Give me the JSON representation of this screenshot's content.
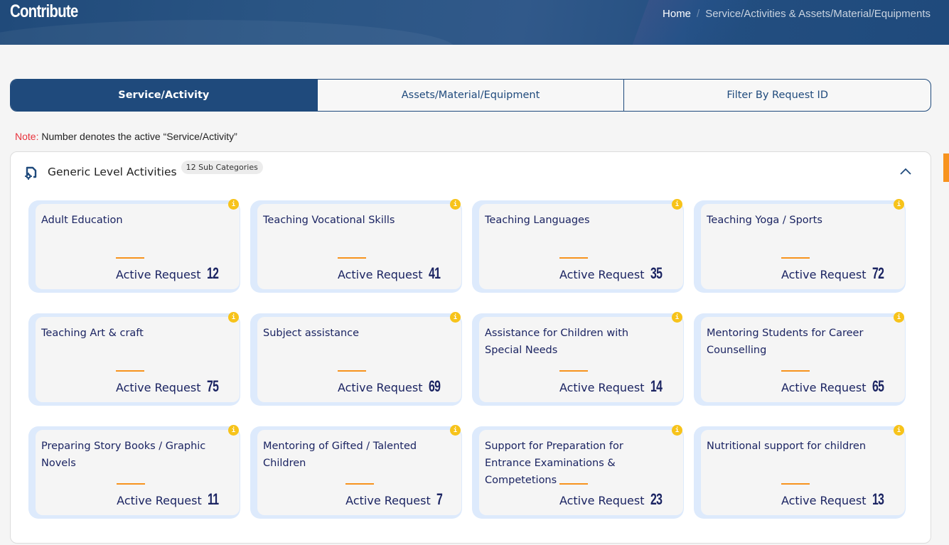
{
  "header": {
    "title": "Contribute",
    "breadcrumb": {
      "home": "Home",
      "separator": "/",
      "current": "Service/Activities & Assets/Material/Equipments"
    }
  },
  "tabs": [
    {
      "label": "Service/Activity",
      "active": true
    },
    {
      "label": "Assets/Material/Equipment",
      "active": false
    },
    {
      "label": "Filter By Request ID",
      "active": false
    }
  ],
  "note": {
    "label": "Note:",
    "text": "Number denotes the active “Service/Activity”"
  },
  "category": {
    "icon": "category-settings-icon",
    "title": "Generic Level Activities",
    "badge": "12 Sub Categories",
    "expanded": true
  },
  "card_label": "Active Request",
  "info_glyph": "i",
  "colors": {
    "primary": "#1f4a7c",
    "accent": "#f7931e",
    "text_dark": "#1b2462",
    "card_border": "#ddeafc",
    "info": "#f7c31a",
    "note_red": "#e8323c"
  },
  "cards": [
    {
      "title": "Adult Education",
      "count": "12"
    },
    {
      "title": "Teaching Vocational Skills",
      "count": "41"
    },
    {
      "title": "Teaching Languages",
      "count": "35"
    },
    {
      "title": "Teaching Yoga / Sports",
      "count": "72"
    },
    {
      "title": "Teaching Art & craft",
      "count": "75"
    },
    {
      "title": "Subject assistance",
      "count": "69"
    },
    {
      "title": "Assistance for Children with Special Needs",
      "count": "14"
    },
    {
      "title": "Mentoring Students for Career Counselling",
      "count": "65"
    },
    {
      "title": "Preparing Story Books / Graphic Novels",
      "count": "11"
    },
    {
      "title": "Mentoring of Gifted / Talented Children",
      "count": "7"
    },
    {
      "title": "Support for Preparation for Entrance Examinations & Competetions",
      "count": "23"
    },
    {
      "title": "Nutritional support for children",
      "count": "13"
    }
  ]
}
